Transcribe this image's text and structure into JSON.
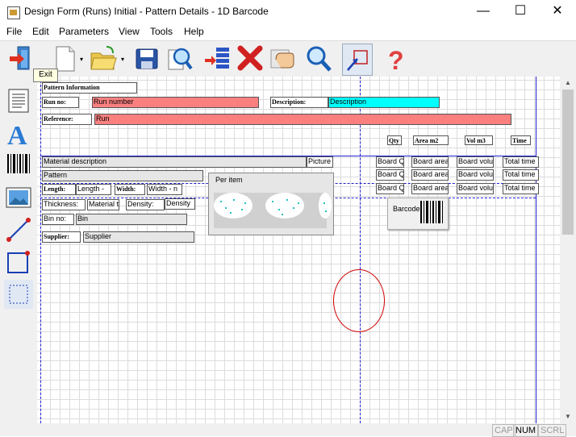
{
  "window": {
    "title": "Design Form (Runs) Initial - Pattern Details - 1D Barcode",
    "minimize_glyph": "—",
    "maximize_glyph": "☐",
    "close_glyph": "✕"
  },
  "menu": [
    "File",
    "Edit",
    "Parameters",
    "View",
    "Tools",
    "Help"
  ],
  "toolbar": {
    "buttons": [
      "exit-icon",
      "new-document-icon",
      "open-folder-icon",
      "save-icon",
      "print-preview-icon",
      "insert-rows-icon",
      "delete-icon",
      "hand-pointer-icon",
      "search-icon",
      "select-region-icon",
      "help-icon"
    ],
    "dropdown_glyph": "▾",
    "tooltip": "Exit"
  },
  "left_tools": [
    "text-block-icon",
    "text-a-icon",
    "barcode-icon",
    "image-icon",
    "line-icon",
    "rectangle-icon",
    "selection-icon"
  ],
  "form": {
    "pattern_information": "Pattern Information",
    "run_no_label": "Run no:",
    "run_number": "Run number",
    "description_label": "Description:",
    "description": "Description",
    "reference_label": "Reference:",
    "run": "Run",
    "qty": "Qty",
    "area_m2": "Area m2",
    "vol_m3": "Vol m3",
    "time": "Time",
    "material_description": "Material description",
    "picture": "Picture",
    "board_q": "Board Q",
    "board_area": "Board area",
    "board_volume": "Board volu",
    "total_time": "Total time",
    "pattern": "Pattern",
    "length_label": "Length:",
    "length_value": "Length - ",
    "width_label": "Width:",
    "width_value": "Width - n",
    "thickness_label": "Thickness:",
    "material_t": "Material t",
    "density_label": "Density:",
    "density": "Density",
    "bin_no_label": "Bin no:",
    "bin": "Bin",
    "supplier_label": "Supplier:",
    "supplier": "Supplier",
    "per_item": "Per item",
    "barcode_text": "Barcode"
  },
  "statusbar": {
    "cap": "CAP",
    "num": "NUM",
    "scrl": "SCRL"
  }
}
